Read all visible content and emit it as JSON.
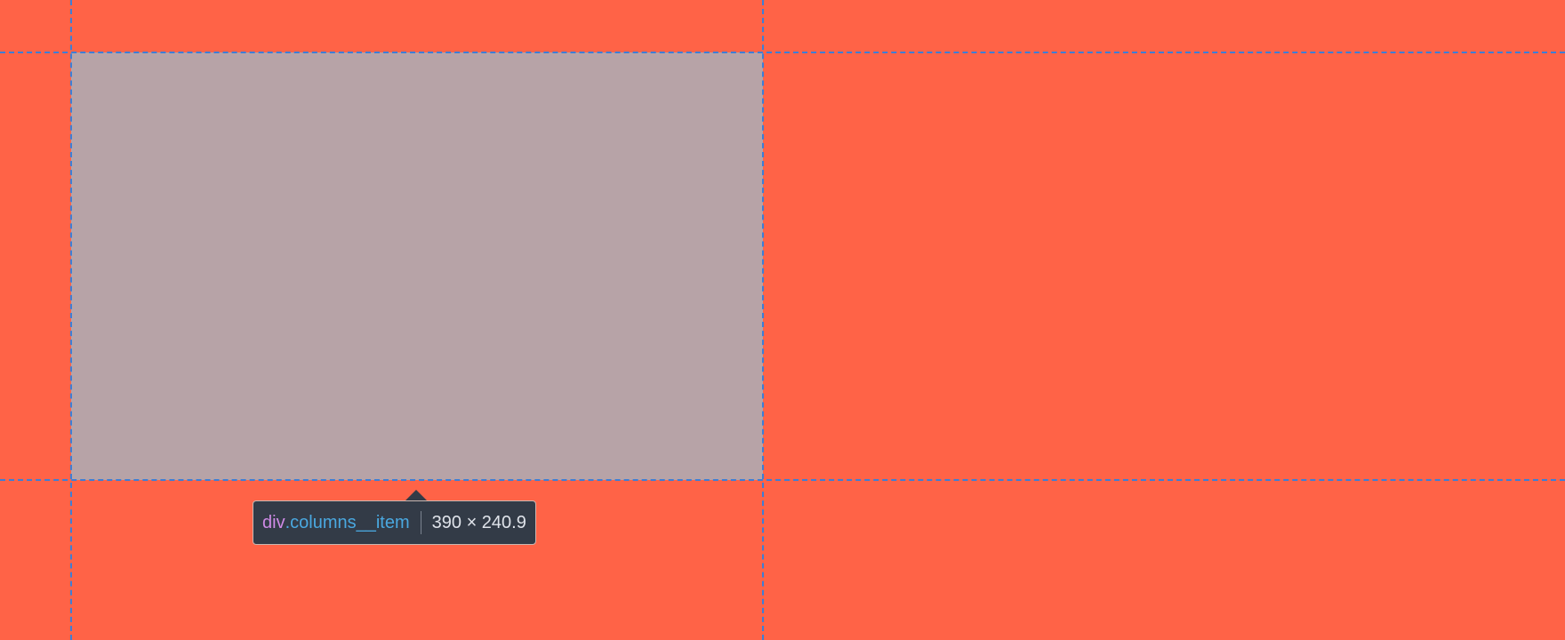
{
  "colors": {
    "page_background": "#ff6347",
    "highlight_overlay": "#b7a3a7",
    "guide_lines": "#3d7ed6",
    "tooltip_background": "#333b47",
    "tag_color": "#cf8ae6",
    "class_color": "#4aa8e0"
  },
  "inspector": {
    "tag": "div",
    "class_name": ".columns__item",
    "dimensions": "390 × 240.9"
  }
}
